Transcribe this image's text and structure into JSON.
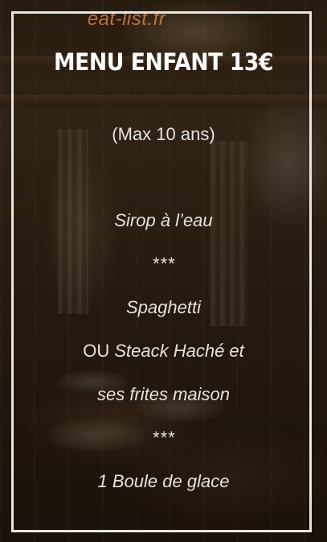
{
  "watermark": "eat-list.fr",
  "menu_card": {
    "title": "MENU ENFANT 13€",
    "subtitle": "(Max 10 ans)",
    "items": [
      {
        "text": "Sirop à l’eau"
      },
      {
        "text": "***"
      },
      {
        "text": "Spaghetti"
      },
      {
        "prefix": "OU ",
        "text": "Steack Haché et"
      },
      {
        "text": "ses frites maison"
      },
      {
        "text": "***"
      },
      {
        "text": "1 Boule de glace"
      }
    ]
  },
  "colors": {
    "watermark": "#d07a40",
    "frame": "#e9e6e1",
    "text": "#e6e3de"
  }
}
